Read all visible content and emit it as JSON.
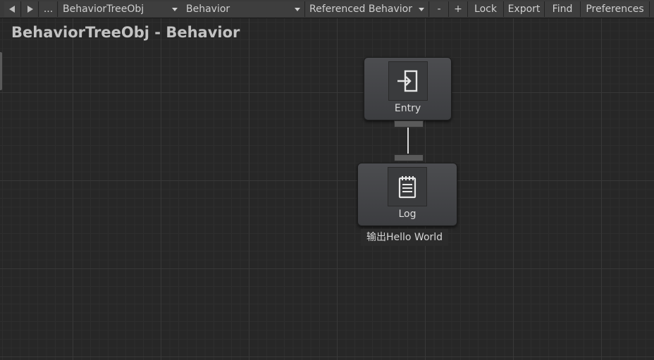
{
  "toolbar": {
    "back_icon": "back-arrow-icon",
    "forward_icon": "forward-arrow-icon",
    "more_label": "...",
    "object_select": "BehaviorTreeObj",
    "behavior_select": "Behavior",
    "referenced_select": "Referenced Behavior",
    "remove_label": "-",
    "add_label": "+",
    "lock_label": "Lock",
    "export_label": "Export",
    "find_label": "Find",
    "preferences_label": "Preferences"
  },
  "canvas": {
    "title": "BehaviorTreeObj - Behavior"
  },
  "nodes": [
    {
      "label": "Entry",
      "icon": "entry-icon"
    },
    {
      "label": "Log",
      "icon": "notepad-icon",
      "comment": "输出Hello World"
    }
  ],
  "colors": {
    "canvas_bg": "#272727",
    "toolbar_bg": "#3a3a3a",
    "node_bg": "#46474a",
    "connector": "#d8d8d8"
  }
}
